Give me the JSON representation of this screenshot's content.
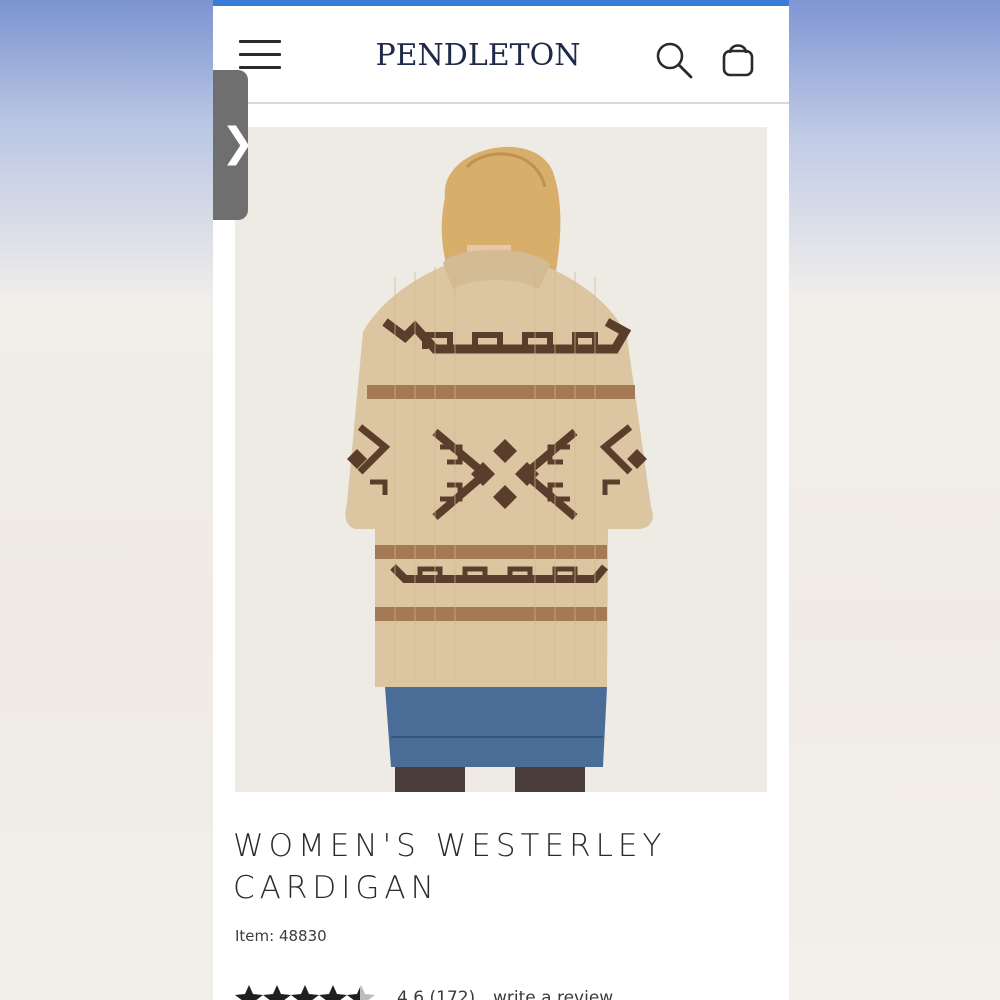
{
  "colors": {
    "accent_bar": "#3a7ad8",
    "brand_navy": "#1f2a4a",
    "sweater_tan": "#dcc6a2",
    "sweater_brown": "#5b3d2c",
    "stripe_camel": "#a47a55",
    "denim": "#4a6d98"
  },
  "header": {
    "logo": "PENDLETON",
    "icons": [
      "menu-icon",
      "search-icon",
      "shopping-bag-icon"
    ]
  },
  "side_tab": {
    "icon": "chevron-right-icon",
    "glyph": "❯"
  },
  "product": {
    "title_line1": "WOMEN'S WESTERLEY",
    "title_line2": "CARDIGAN",
    "item_number": "Item: 48830",
    "rating": "4.6",
    "review_count": "(172)",
    "rating_stars_filled": 4.6,
    "write_review": "write a review"
  },
  "carousel": {
    "slide_count": 5,
    "active_slide": 3
  }
}
